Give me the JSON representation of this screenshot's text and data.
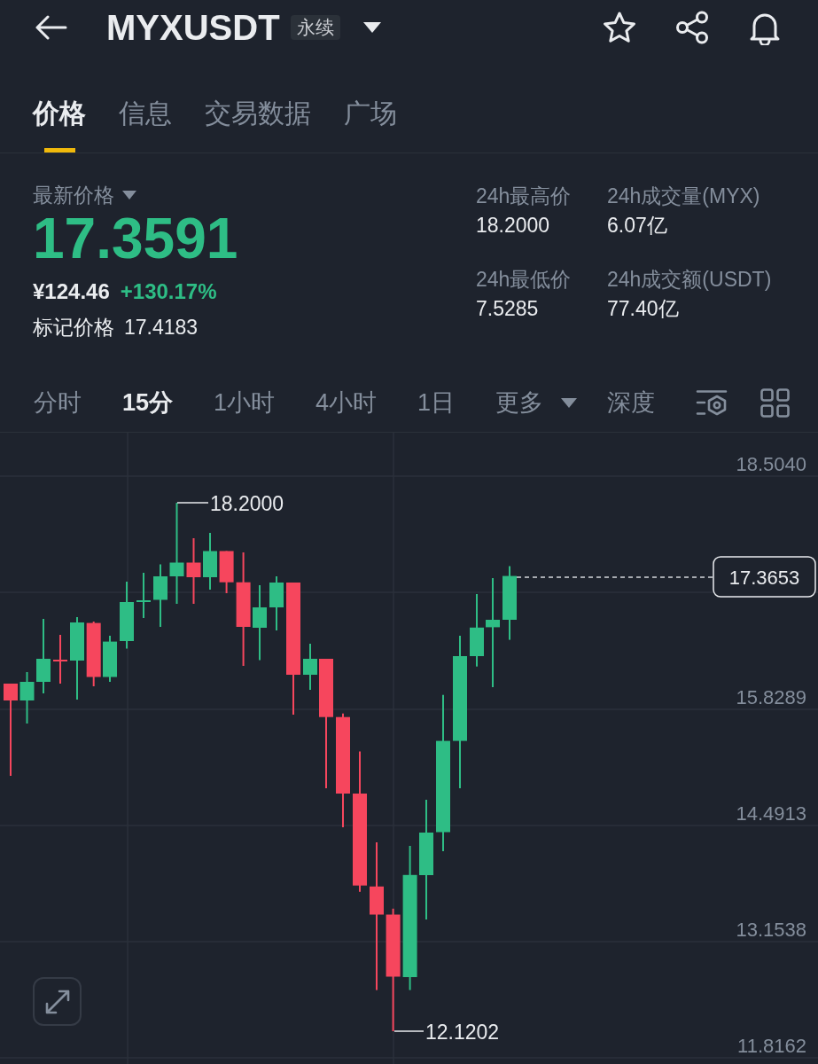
{
  "header": {
    "title": "MYXUSDT",
    "badge": "永续"
  },
  "tabs": [
    {
      "label": "价格",
      "selected": true
    },
    {
      "label": "信息",
      "selected": false
    },
    {
      "label": "交易数据",
      "selected": false
    },
    {
      "label": "广场",
      "selected": false
    }
  ],
  "ticker": {
    "label": "最新价格",
    "last_price": "17.3591",
    "rising": true,
    "cny_price": "¥124.46",
    "change": "+130.17%",
    "mark_price_label": "标记价格",
    "mark_price": "17.4183"
  },
  "stats": [
    {
      "label": "24h最高价",
      "value": "18.2000"
    },
    {
      "label": "24h成交量(MYX)",
      "value": "6.07亿"
    },
    {
      "label": "24h最低价",
      "value": "7.5285"
    },
    {
      "label": "24h成交额(USDT)",
      "value": "77.40亿"
    }
  ],
  "intervals": [
    {
      "label": "分时",
      "kind": "interval",
      "selected": false
    },
    {
      "label": "15分",
      "kind": "interval",
      "selected": true
    },
    {
      "label": "1小时",
      "kind": "interval",
      "selected": false
    },
    {
      "label": "4小时",
      "kind": "interval",
      "selected": false
    },
    {
      "label": "1日",
      "kind": "interval",
      "selected": false
    },
    {
      "label": "更多",
      "kind": "dropdown",
      "selected": false
    },
    {
      "label": "深度",
      "kind": "interval",
      "selected": false
    }
  ],
  "chart": {
    "y_axis_labels": [
      "18.5040",
      "15.8289",
      "14.4913",
      "13.1538",
      "11.8162"
    ],
    "current_price": "17.3653",
    "high_label": "18.2000",
    "low_label": "12.1202"
  }
}
